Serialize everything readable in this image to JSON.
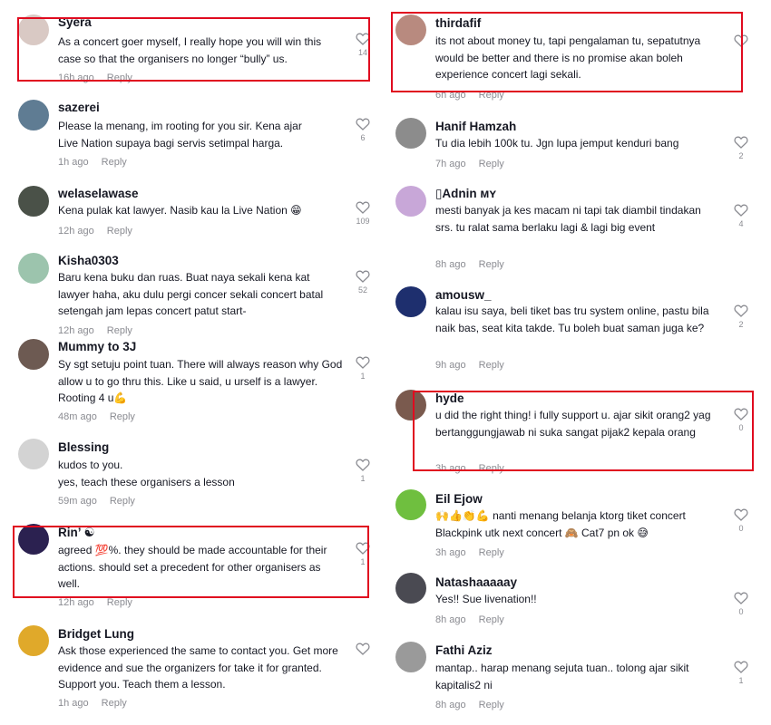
{
  "reply_label": "Reply",
  "left_column": [
    {
      "user": "Syera",
      "text": "As a concert goer myself, I really hope you will win this case so that the organisers no longer “bully” us.",
      "time": "16h ago",
      "likes": "14",
      "avatar_color": "#d9c9c4"
    },
    {
      "user": "sazerei",
      "text": "Please la menang, im rooting for you sir. Kena ajar Live Nation supaya bagi servis setimpal harga.",
      "time": "1h ago",
      "likes": "6",
      "avatar_color": "#5f7c93"
    },
    {
      "user": "welaselawase",
      "text": "Kena pulak kat lawyer. Nasib kau la Live Nation 😁",
      "time": "12h ago",
      "likes": "109",
      "avatar_color": "#4a5148"
    },
    {
      "user": "Kisha0303",
      "text": "Baru kena buku dan ruas. Buat naya sekali kena kat lawyer haha, aku dulu pergi concer sekali concert batal setengah jam lepas concert patut start-",
      "time": "12h ago",
      "likes": "52",
      "avatar_color": "#9cc4ad"
    },
    {
      "user": "Mummy to 3J",
      "text": "Sy sgt setuju point tuan. There will always reason why God allow u to go thru this. Like u said, u urself is a lawyer. Rooting 4 u💪",
      "time": "48m ago",
      "likes": "1",
      "avatar_color": "#6d5a52"
    },
    {
      "user": "Blessing",
      "text": "kudos to you.\nyes, teach these organisers a lesson",
      "time": "59m ago",
      "likes": "1",
      "avatar_color": "#d3d3d3"
    },
    {
      "user": "Rin’ ☯",
      "text": "agreed 💯%. they should be made accountable for their actions. should set a precedent for other organisers as well.",
      "time": "12h ago",
      "likes": "1",
      "avatar_color": "#2b2150"
    },
    {
      "user": "Bridget Lung",
      "text": "Ask those experienced the same to contact you. Get more evidence and sue the organizers for take it for granted. Support you. Teach them a lesson.",
      "time": "1h ago",
      "likes": "",
      "avatar_color": "#e0a92a"
    }
  ],
  "right_column": [
    {
      "user": "thirdafif",
      "text": "its not about money tu, tapi pengalaman tu, sepatutnya would be better and there is no promise akan boleh experience concert lagi sekali.",
      "time": "6h ago",
      "likes": "",
      "avatar_color": "#b88a7f"
    },
    {
      "user": "Hanif Hamzah",
      "text": "Tu dia lebih 100k tu. Jgn lupa jemput kenduri bang",
      "time": "7h ago",
      "likes": "2",
      "avatar_color": "#8c8c8c"
    },
    {
      "user": "▯Adnin ᴍʏ",
      "text": "mesti banyak ja kes macam ni tapi tak diambil tindakan srs. tu ralat sama berlaku lagi & lagi big event",
      "time": "8h ago",
      "likes": "4",
      "avatar_color": "#c8a7d8"
    },
    {
      "user": "amousw_",
      "text": "kalau isu saya, beli tiket bas tru system online, pastu bila naik bas, seat kita takde. Tu boleh buat saman juga ke?",
      "time": "9h ago",
      "likes": "2",
      "avatar_color": "#1e2f6e"
    },
    {
      "user": "hyde",
      "text": "u did the right thing! i fully support u. ajar sikit orang2 yag bertanggungjawab ni suka sangat pijak2 kepala orang",
      "time": "3h ago",
      "likes": "0",
      "avatar_color": "#7a5a4e"
    },
    {
      "user": "Eil Ejow",
      "text": "🙌👍👏💪 nanti menang belanja ktorg tiket concert Blackpink utk next concert 🙈 Cat7 pn ok 😅",
      "time": "3h ago",
      "likes": "0",
      "avatar_color": "#6fbf3f"
    },
    {
      "user": "Natashaaaaay",
      "text": "Yes!! Sue livenation!!",
      "time": "8h ago",
      "likes": "0",
      "avatar_color": "#4a4a52"
    },
    {
      "user": "Fathi Aziz",
      "text": "mantap.. harap menang sejuta tuan.. tolong ajar sikit kapitalis2 ni",
      "time": "8h ago",
      "likes": "1",
      "avatar_color": "#9a9a9a"
    }
  ],
  "highlight_color": "#e00b1f"
}
